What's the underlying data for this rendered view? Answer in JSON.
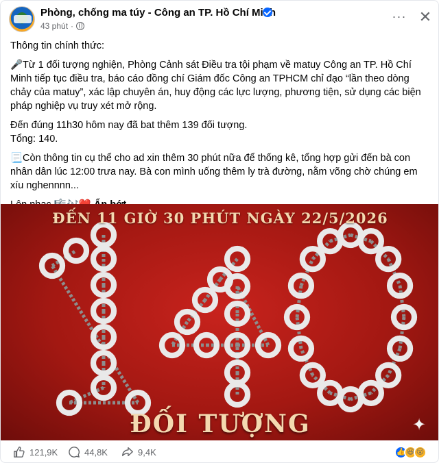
{
  "post": {
    "page_name": "Phòng, chống ma túy - Công an TP. Hồ Chí Minh",
    "time": "43 phút",
    "more_label": "···",
    "close_label": "✕"
  },
  "body": {
    "p1": "Thông tin chính thức:",
    "p2": "🎤Từ 1 đối tượng nghiện, Phòng Cảnh sát Điều tra tội phạm về matuy Công an TP. Hồ Chí Minh tiếp tục điều tra, báo cáo đồng chí Giám đốc Công an TPHCM chỉ đạo “lần theo dòng chảy của matuy”, xác lập chuyên án, huy động các lực lượng, phương tiện, sử dụng các biện pháp nghiệp vụ truy xét mở rộng.",
    "p3": "Đến đúng 11h30 hôm nay đã bat thêm 139 đối tượng.",
    "p4": "Tổng: 140.",
    "p5": "📃Còn thông tin cụ thể cho ad xin thêm 30 phút nữa để thống kê, tổng hợp gửi đến bà con nhân dân lúc 12:00 trưa nay. Bà con mình uống thêm ly trà đường, nằm võng chờ chúng em xíu nghennnn...",
    "p6": "Lên nhạc 🎼🎶❤️",
    "see_less": "Ẩn bớt"
  },
  "image": {
    "caption_top": "ĐẾN 11 GIỜ 30 PHÚT NGÀY 22/5/2026",
    "big_number": "140",
    "caption_bottom": "ĐỐI TƯỢNG",
    "colors": {
      "background": "#a31812",
      "cuff": "#e9e9e9",
      "text": "#f4d9b0"
    }
  },
  "actions": {
    "likes": "121,9K",
    "comments": "44,8K",
    "shares": "9,4K"
  },
  "icons": {
    "avatar": "police-logo",
    "verified": "verified-badge-icon",
    "privacy": "globe-icon",
    "like": "thumbs-up-icon",
    "comment": "comment-bubble-icon",
    "share": "share-arrow-icon"
  }
}
